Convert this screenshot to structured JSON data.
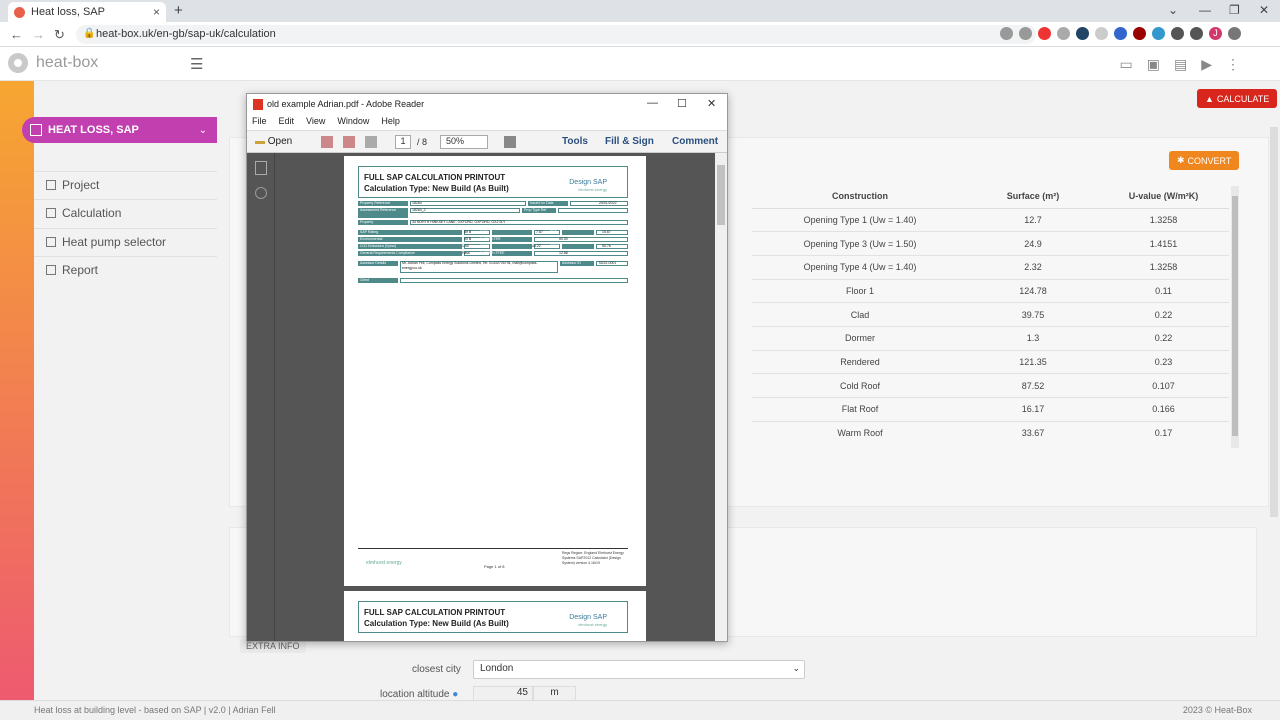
{
  "browser": {
    "tab_title": "Heat loss, SAP",
    "tab_close": "×",
    "new_tab": "+",
    "url": "heat-box.uk/en-gb/sap-uk/calculation",
    "profile_initial": "J"
  },
  "app": {
    "logo_text": "heat-box",
    "calculate_label": "CALCULATE",
    "convert_label": "CONVERT"
  },
  "sidebar": {
    "menu_head": "HEAT LOSS, SAP",
    "items": [
      {
        "label": "Project"
      },
      {
        "label": "Calculation"
      },
      {
        "label": "Heat pump selector"
      },
      {
        "label": "Report"
      }
    ]
  },
  "table": {
    "headers": [
      "Construction",
      "Surface (m²)",
      "U-value (W/m²K)"
    ],
    "rows": [
      [
        "Opening Type 1 (Uw = 1.40)",
        "12.7",
        "1.3258"
      ],
      [
        "Opening Type 3 (Uw = 1.50)",
        "24.9",
        "1.4151"
      ],
      [
        "Opening Type 4 (Uw = 1.40)",
        "2.32",
        "1.3258"
      ],
      [
        "Floor 1",
        "124.78",
        "0.11"
      ],
      [
        "Clad",
        "39.75",
        "0.22"
      ],
      [
        "Dormer",
        "1.3",
        "0.22"
      ],
      [
        "Rendered",
        "121.35",
        "0.23"
      ],
      [
        "Cold Roof",
        "87.52",
        "0.107"
      ],
      [
        "Flat Roof",
        "16.17",
        "0.166"
      ],
      [
        "Warm Roof",
        "33.67",
        "0.17"
      ]
    ]
  },
  "extra": {
    "section_label": "EXTRA INFO",
    "city_label": "closest city",
    "city_value": "London",
    "altitude_label": "location altitude",
    "altitude_value": "45",
    "altitude_unit": "m"
  },
  "footer": {
    "left": "Heat loss at building level - based on SAP  |  v2.0  |  Adrian Fell",
    "right": "2023 © Heat-Box"
  },
  "reader": {
    "title": "old example Adrian.pdf - Adobe Reader",
    "menu": [
      "File",
      "Edit",
      "View",
      "Window",
      "Help"
    ],
    "open_label": "Open",
    "page_current": "1",
    "page_total": "/ 8",
    "zoom": "50%",
    "tools": "Tools",
    "fill_sign": "Fill & Sign",
    "comment": "Comment"
  },
  "pdf": {
    "title1": "FULL SAP CALCULATION PRINTOUT",
    "title2": "Calculation Type: New Build (As Built)",
    "brand": "Design SAP",
    "brand_sub": "elmhurst energy",
    "property_ref_label": "Property Reference",
    "property_ref": "18264",
    "issued_label": "Issued on Date",
    "issued": "25/01/2022",
    "assessment_label": "Assessment Reference",
    "assessment": "18264_2",
    "prop_type_label": "Prop Type Ref",
    "property_label": "Property",
    "property": "34 NORTH HINKSEY LANE, OXFORD, OXFORD, OX2 0LY",
    "sap_label": "SAP Rating",
    "sap": "89 B",
    "der_label": "DER",
    "der": "7.87",
    "ter_label": "TER",
    "ter": "15.67",
    "env_label": "Environmental",
    "env": "90 B",
    "derter_label": "% DER<TER",
    "derter": "50.00",
    "co2_label": "CO2 Emissions (t/year)",
    "co2": "1.50",
    "dfee_label": "DFEE",
    "dfee": "44.22",
    "tfee_label": "TFEE",
    "tfee": "50.76",
    "gen_label": "General Requirements Compliance",
    "gen": "Pass",
    "dfeetfee_label": "% DFEE<TFEE",
    "dfeetfee": "12.88",
    "assessor_label": "Assessor Details",
    "assessor": "Mr. Adrian Fell, Compass Energy Solutions Limited, Tel: 01440705794, mail@compass-energy.co.uk",
    "assessor_id_label": "Assessor ID",
    "assessor_id": "N222-0001",
    "client_label": "Client",
    "footer_logo": "elmhurst energy",
    "footer_page": "Page 1 of 8",
    "footer_right": "Regs Region: England Elmhurst Energy Systems SAP2012 Calculator (Design System) version 4.16r19",
    "page2_title1": "FULL SAP CALCULATION PRINTOUT",
    "page2_title2": "Calculation Type: New Build (As Built)",
    "page2_brand": "Design SAP",
    "page2_brand_sub": "elmhurst energy"
  }
}
